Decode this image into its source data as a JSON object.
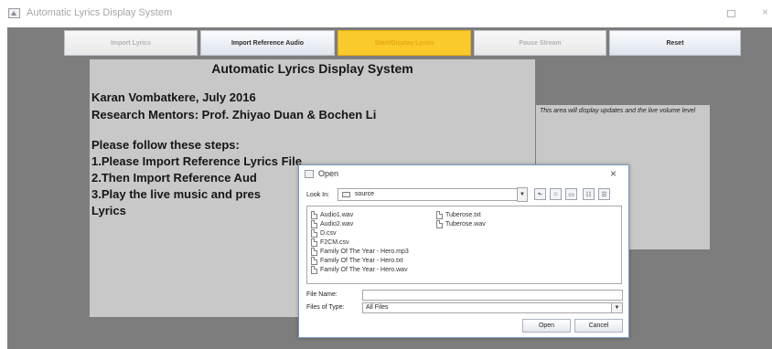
{
  "window": {
    "title": "Automatic Lyrics Display System",
    "controls": {
      "maximize": "□",
      "close": "×"
    }
  },
  "toolbar": {
    "buttons": [
      {
        "label": "Import Lyrics",
        "state": "disabled"
      },
      {
        "label": "Import Reference Audio",
        "state": "enabled"
      },
      {
        "label": "Start/Display Lyrics",
        "state": "highlighted"
      },
      {
        "label": "Pause Stream",
        "state": "disabled"
      },
      {
        "label": "Reset",
        "state": "enabled"
      }
    ]
  },
  "lyrics_panel": {
    "title": "Automatic Lyrics Display System",
    "lines": [
      "Karan Vombatkere, July 2016",
      "Research Mentors: Prof. Zhiyao Duan & Bochen Li",
      "Please follow these steps:",
      "1.Please Import Reference Lyrics File",
      "2.Then Import Reference Aud",
      "3.Play the live music and pres",
      "Lyrics"
    ]
  },
  "update_panel": {
    "text": "This area will display updates and the live volume level"
  },
  "open_dialog": {
    "title": "Open",
    "close_glyph": "×",
    "look_in_label": "Look In:",
    "look_in_value": "source",
    "dropdown_arrow": "▼",
    "nav_buttons": [
      {
        "name": "up-folder-icon",
        "glyph": "⬑"
      },
      {
        "name": "home-folder-icon",
        "glyph": "⌂"
      },
      {
        "name": "new-folder-icon",
        "glyph": "▭"
      },
      {
        "name": "list-view-icon",
        "glyph": "☷"
      },
      {
        "name": "details-view-icon",
        "glyph": "☰"
      }
    ],
    "files": [
      {
        "name": "Audio1.wav"
      },
      {
        "name": "Audio2.wav"
      },
      {
        "name": "D.csv"
      },
      {
        "name": "F2CM.csv"
      },
      {
        "name": "Family Of The Year - Hero.mp3"
      },
      {
        "name": "Family Of The Year - Hero.txt"
      },
      {
        "name": "Family Of The Year - Hero.wav"
      },
      {
        "name": "Tuberose.txt"
      },
      {
        "name": "Tuberose.wav"
      }
    ],
    "file_name_label": "File Name:",
    "file_name_value": "",
    "files_of_type_label": "Files of Type:",
    "files_of_type_value": "All Files",
    "open_button": "Open",
    "cancel_button": "Cancel"
  }
}
